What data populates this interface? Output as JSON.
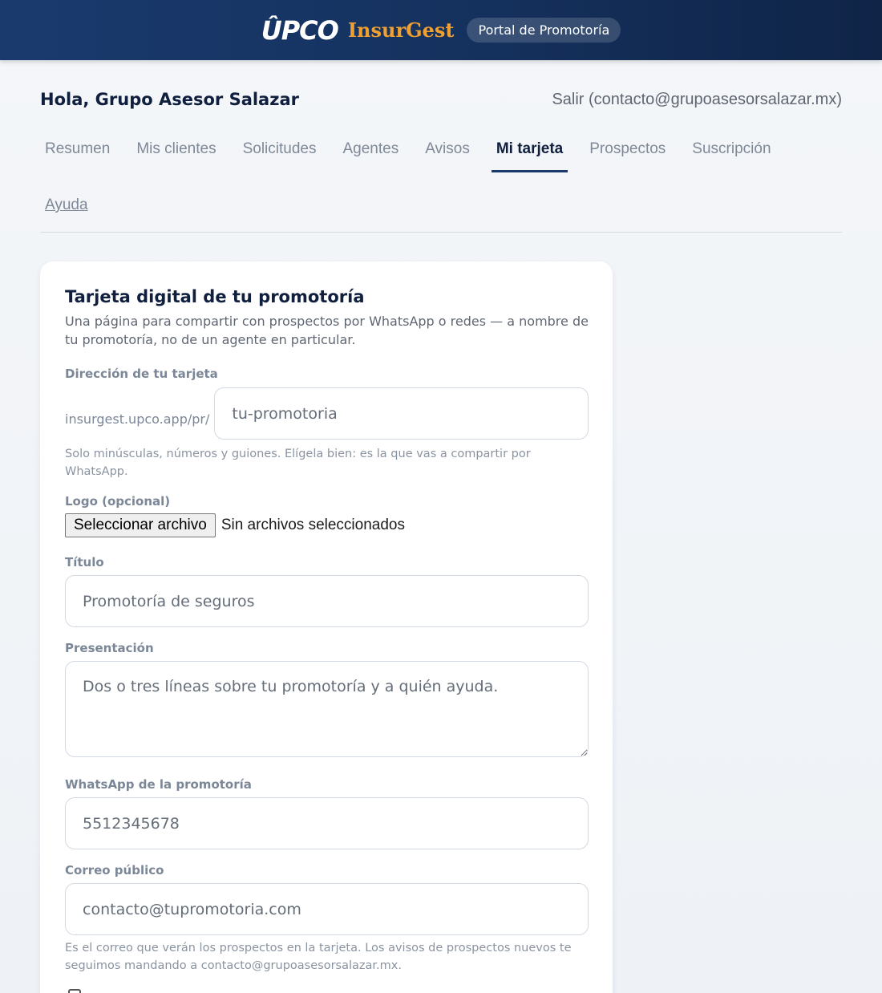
{
  "header": {
    "logo_upco": "ÛPCO",
    "logo_insurgest": "InsurGest",
    "portal_label": "Portal de Promotoría"
  },
  "greeting": "Hola, Grupo Asesor Salazar",
  "logout": "Salir (contacto@grupoasesorsalazar.mx)",
  "tabs": [
    {
      "label": "Resumen"
    },
    {
      "label": "Mis clientes"
    },
    {
      "label": "Solicitudes"
    },
    {
      "label": "Agentes"
    },
    {
      "label": "Avisos"
    },
    {
      "label": "Mi tarjeta"
    },
    {
      "label": "Prospectos"
    },
    {
      "label": "Suscripción"
    },
    {
      "label": "Ayuda"
    }
  ],
  "card": {
    "title": "Tarjeta digital de tu promotoría",
    "description": "Una página para compartir con prospectos por WhatsApp o redes — a nombre de tu promotoría, no de un agente en particular.",
    "address": {
      "label": "Dirección de tu tarjeta",
      "prefix": "insurgest.upco.app/pr/",
      "placeholder": "tu-promotoria",
      "hint": "Solo minúsculas, números y guiones. Elígela bien: es la que vas a compartir por WhatsApp."
    },
    "logo": {
      "label": "Logo (opcional)",
      "button": "Seleccionar archivo",
      "status": "Sin archivos seleccionados"
    },
    "title_field": {
      "label": "Título",
      "placeholder": "Promotoría de seguros"
    },
    "presentation": {
      "label": "Presentación",
      "placeholder": "Dos o tres líneas sobre tu promotoría y a quién ayuda."
    },
    "whatsapp": {
      "label": "WhatsApp de la promotoría",
      "placeholder": "5512345678"
    },
    "email": {
      "label": "Correo público",
      "placeholder": "contacto@tupromotoria.com",
      "hint": "Es el correo que verán los prospectos en la tarjeta. Los avisos de prospectos nuevos te seguimos mandando a contacto@grupoasesorsalazar.mx."
    }
  }
}
